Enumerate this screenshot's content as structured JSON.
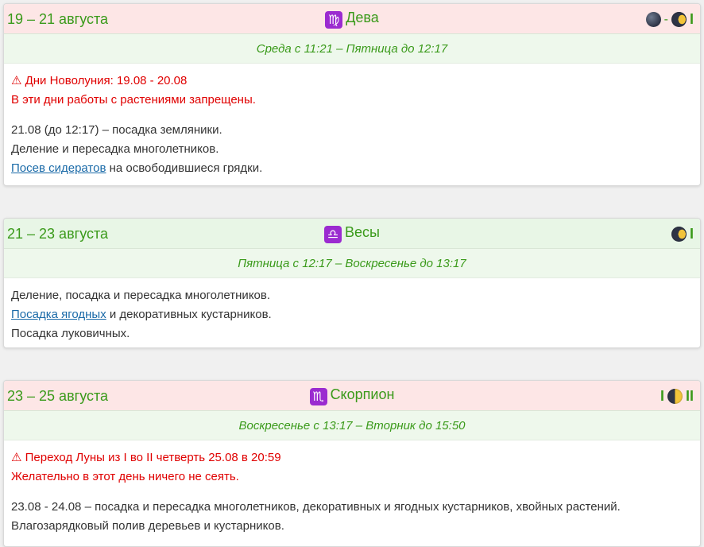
{
  "cards": [
    {
      "dates": "19 – 21 августа",
      "sign_icon": "♍",
      "sign_name": "Дева",
      "moon_sep": "-",
      "moon_end": "I",
      "period": "Среда с 11:21 – Пятница до 12:17",
      "warning_line1": "⚠ Дни Новолуния: 19.08 - 20.08",
      "warning_line2": "В эти дни работы с растениями запрещены.",
      "line1": "21.08 (до 12:17) – посадка земляники.",
      "line2": "Деление и пересадка многолетников.",
      "line3_link": "Посев сидератов",
      "line3_rest": " на освободившиеся грядки."
    },
    {
      "dates": "21 – 23 августа",
      "sign_icon": "♎",
      "sign_name": "Весы",
      "moon_end": "I",
      "period": "Пятница с 12:17 – Воскресенье до 13:17",
      "line1": "Деление, посадка и пересадка многолетников.",
      "line2_link": "Посадка ягодных",
      "line2_rest": " и декоративных кустарников.",
      "line3": "Посадка луковичных."
    },
    {
      "dates": "23 – 25 августа",
      "sign_icon": "♏",
      "sign_name": "Скорпион",
      "moon_start": "I",
      "moon_end": "II",
      "period": "Воскресенье с 13:17 – Вторник до 15:50",
      "warning_line1": "⚠ Переход Луны из I во II четверть 25.08 в 20:59",
      "warning_line2": "Желательно в этот день ничего не сеять.",
      "line1": "23.08 - 24.08 – посадка и пересадка многолетников, декоративных и ягодных кустарников, хвойных растений.",
      "line2": "Влагозарядковый полив деревьев и кустарников."
    }
  ],
  "colors": {
    "accent_green": "#3a9a1a",
    "warning_red": "#e00000",
    "link_blue": "#1a6aa8",
    "header_red_bg": "#fde6e6",
    "header_green_bg": "#e8f6e6",
    "sign_purple": "#9b2bd0"
  },
  "icons": {
    "warning": "warning-icon",
    "moon_new": "new-moon-icon",
    "moon_waxing": "waxing-moon-icon",
    "first_quarter": "first-quarter-moon-icon"
  }
}
